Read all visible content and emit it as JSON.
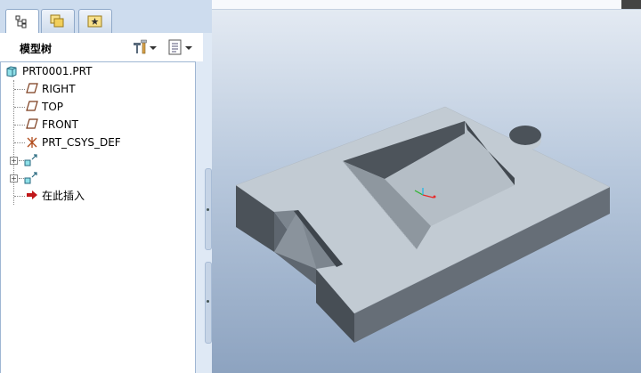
{
  "tabs": [
    {
      "icon": "model-tree-icon",
      "active": true
    },
    {
      "icon": "folder-browser-icon",
      "active": false
    },
    {
      "icon": "favorites-icon",
      "active": false
    }
  ],
  "tree": {
    "title": "模型树",
    "settings_icon": "tools-icon",
    "show_icon": "show-list-icon",
    "items": [
      {
        "label": "PRT0001.PRT",
        "icon": "part-icon"
      },
      {
        "label": "RIGHT",
        "icon": "datum-plane-icon"
      },
      {
        "label": "TOP",
        "icon": "datum-plane-icon"
      },
      {
        "label": "FRONT",
        "icon": "datum-plane-icon"
      },
      {
        "label": "PRT_CSYS_DEF",
        "icon": "csys-icon"
      },
      {
        "label": "",
        "icon": "extrude-feature-icon"
      },
      {
        "label": "",
        "icon": "extrude-feature-icon"
      },
      {
        "label": "在此插入",
        "icon": "insert-here-arrow-icon"
      }
    ]
  },
  "viewport": {
    "model": "3d-part-model",
    "background_top": "#e6ecf4",
    "background_bottom": "#8da3c0"
  }
}
